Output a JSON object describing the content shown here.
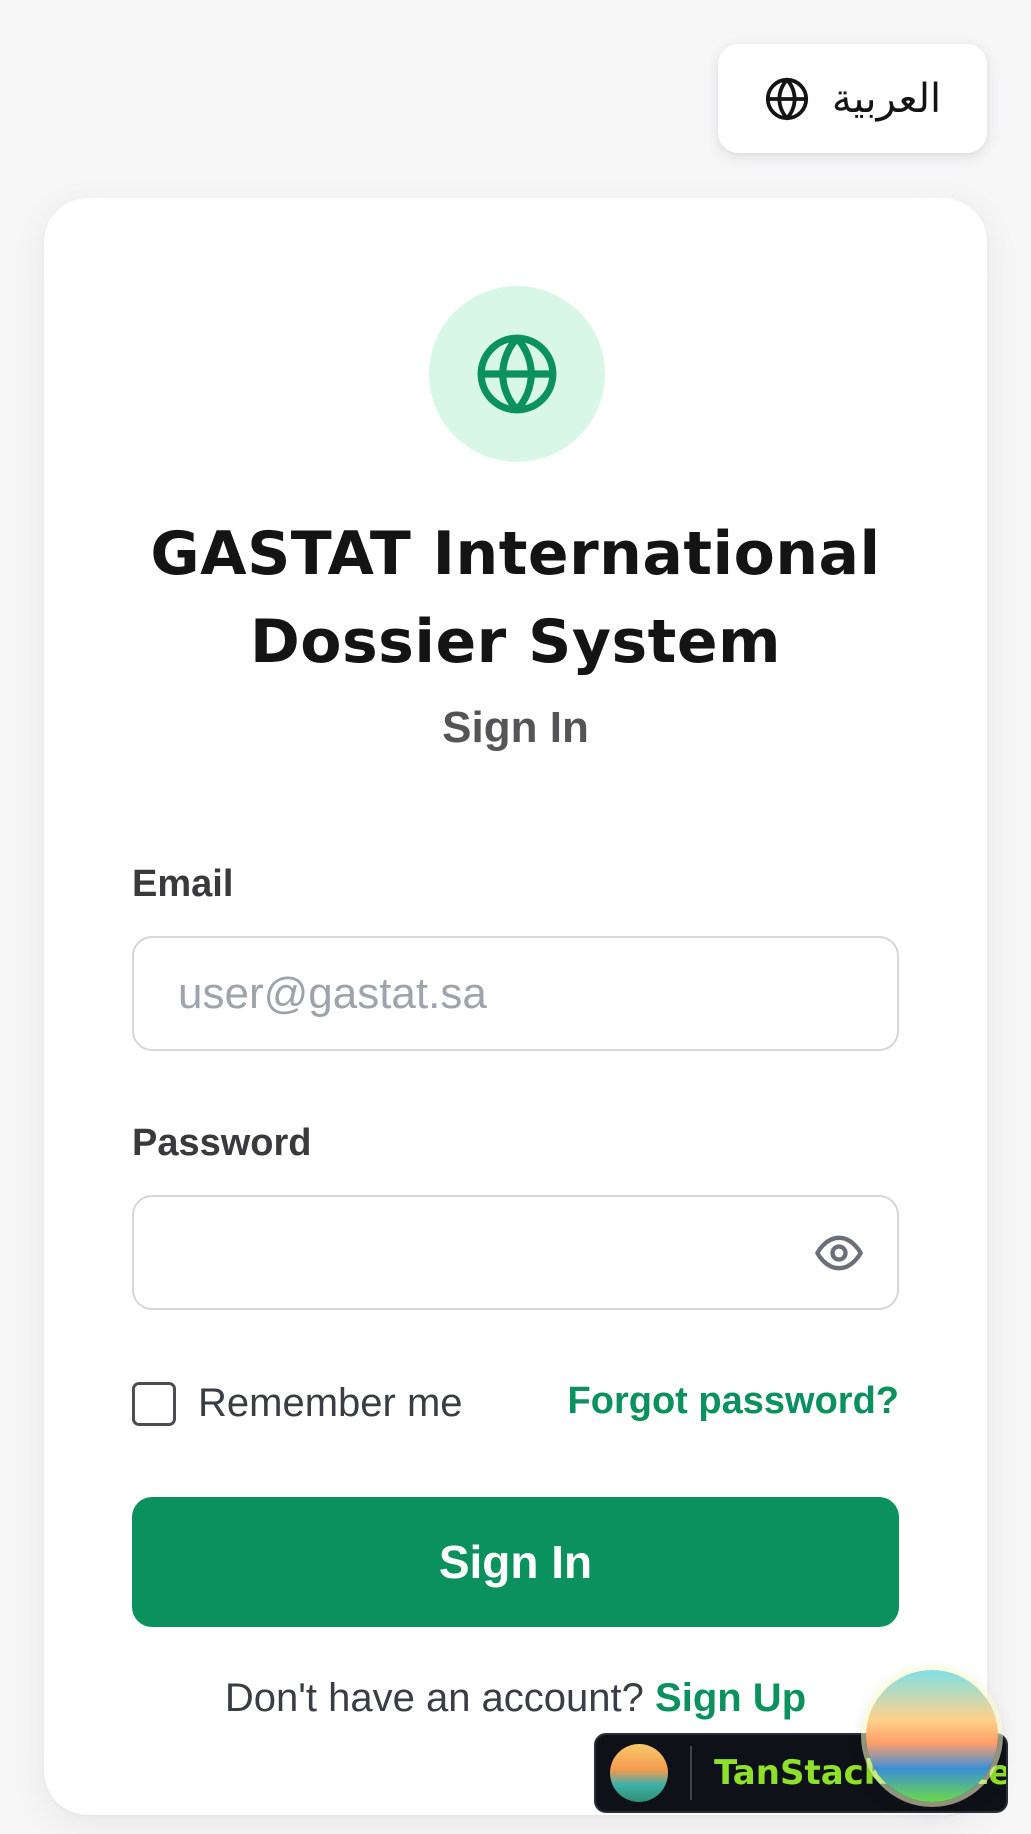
{
  "language_toggle": {
    "label": "العربية",
    "icon": "globe-icon"
  },
  "header": {
    "logo_icon": "globe-icon",
    "title": "GASTAT International Dossier System",
    "subtitle": "Sign In"
  },
  "form": {
    "email": {
      "label": "Email",
      "value": "",
      "placeholder": "user@gastat.sa"
    },
    "password": {
      "label": "Password",
      "value": "",
      "placeholder": "",
      "toggle_icon": "eye-icon"
    },
    "remember": {
      "label": "Remember me",
      "checked": false
    },
    "forgot_label": "Forgot password?",
    "submit_label": "Sign In"
  },
  "footer": {
    "prompt": "Don't have an account?",
    "signup_label": "Sign Up"
  },
  "devtools": {
    "label": "TanStack Router"
  },
  "colors": {
    "accent": "#0a915e",
    "logo_bg": "#d9f7e6",
    "page_bg": "#f6f6f7"
  }
}
